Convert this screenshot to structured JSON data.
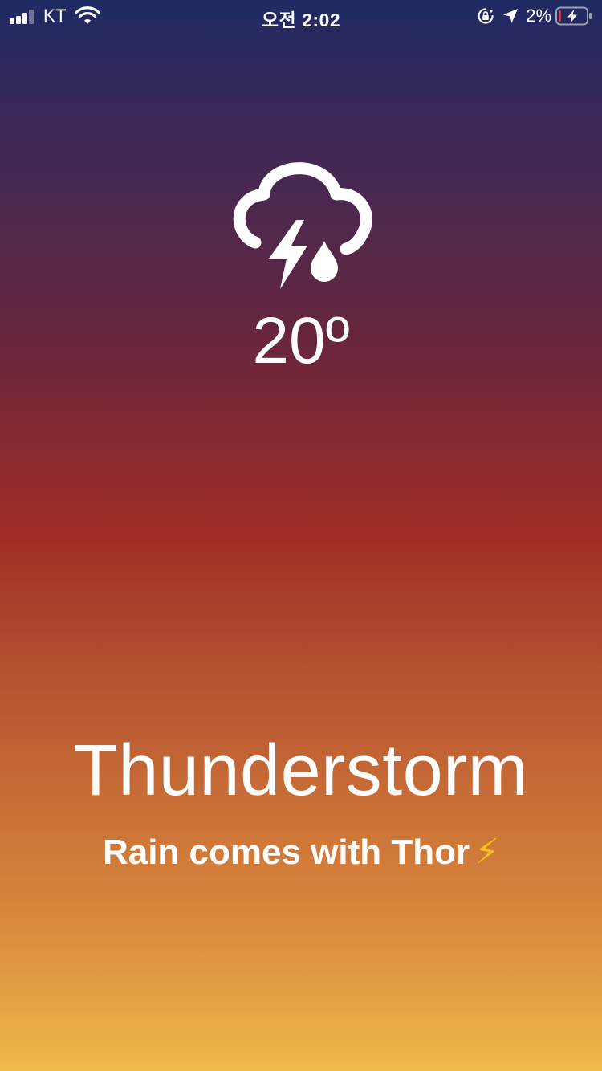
{
  "status_bar": {
    "carrier": "KT",
    "time": "오전 2:02",
    "battery_percent": "2%",
    "signal_bars_filled": 3,
    "signal_bars_total": 4,
    "icons": [
      "signal-bars-icon",
      "wifi-icon",
      "rotation-lock-icon",
      "location-arrow-icon",
      "battery-charging-icon"
    ]
  },
  "weather": {
    "icon": "thunderstorm-rain-icon",
    "temperature": "20º",
    "condition": "Thunderstorm",
    "subtitle": "Rain comes with Thor",
    "subtitle_emoji": "⚡"
  },
  "colors": {
    "gradient_top": "#1f2a63",
    "gradient_mid": "#a02d25",
    "gradient_bottom": "#efb94b",
    "text": "#ffffff",
    "emoji_bolt": "#f7c21b",
    "battery_low": "#ff3b30"
  }
}
